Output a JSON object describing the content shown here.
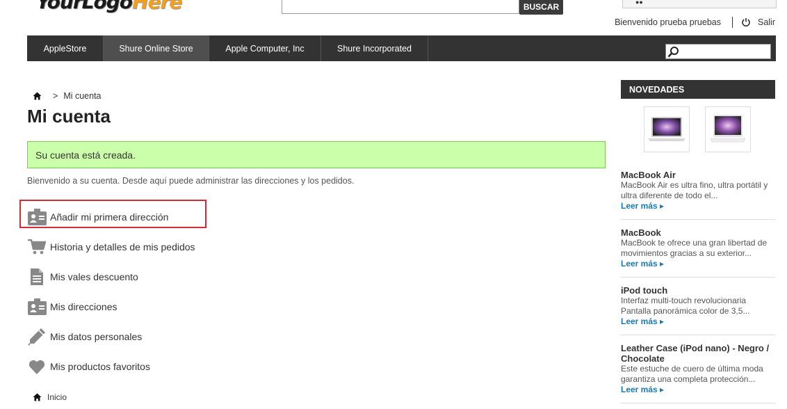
{
  "header": {
    "logo_main": "YourLogo",
    "logo_accent": "Here",
    "search_button": "BUSCAR",
    "welcome_user": "Bienvenido prueba pruebas",
    "logout": "Salir"
  },
  "nav": {
    "items": [
      {
        "label": "AppleStore",
        "active": false
      },
      {
        "label": "Shure Online Store",
        "active": true
      },
      {
        "label": "Apple Computer, Inc",
        "active": false
      },
      {
        "label": "Shure Incorporated",
        "active": false
      }
    ],
    "search_placeholder": ""
  },
  "breadcrumb": {
    "separator": ">",
    "current": "Mi cuenta"
  },
  "main": {
    "title": "Mi cuenta",
    "alert": "Su cuenta está creada.",
    "welcome": "Bienvenido a su cuenta. Desde aquí puede administrar las direcciones y los pedidos.",
    "items": [
      {
        "label": "Añadir mi primera dirección",
        "icon": "address-card-icon"
      },
      {
        "label": "Historia y detalles de mis pedidos",
        "icon": "cart-icon"
      },
      {
        "label": "Mis vales descuento",
        "icon": "document-icon"
      },
      {
        "label": "Mis direcciones",
        "icon": "address-card-icon"
      },
      {
        "label": "Mis datos personales",
        "icon": "pencil-icon"
      },
      {
        "label": "Mis productos favoritos",
        "icon": "heart-icon"
      }
    ],
    "home_link": "Inicio"
  },
  "sidebar": {
    "title": "NOVEDADES",
    "products": [
      {
        "name": "MacBook Air",
        "desc1": "MacBook Air es ultra fino, ultra portátil y",
        "desc2": "ultra diferente de todo el...",
        "more": "Leer más"
      },
      {
        "name": "MacBook",
        "desc1": "MacBook te ofrece una gran libertad de",
        "desc2": "movimientos gracias a su exterior...",
        "more": "Leer más"
      },
      {
        "name": "iPod touch",
        "desc1": "Interfaz multi-touch revolucionaria",
        "desc2": "Pantalla panorámica color de 3,5...",
        "more": "Leer más"
      },
      {
        "name": "Leather Case (iPod nano) - Negro / Chocolate",
        "desc1": "Este estuche de cuero de última moda",
        "desc2": "garantiza una completa protección...",
        "more": "Leer más"
      }
    ]
  },
  "colors": {
    "nav_bg": "#333333",
    "alert_bg": "#ccffaa",
    "highlight_border": "#d52b32",
    "link": "#1a7ab8"
  }
}
